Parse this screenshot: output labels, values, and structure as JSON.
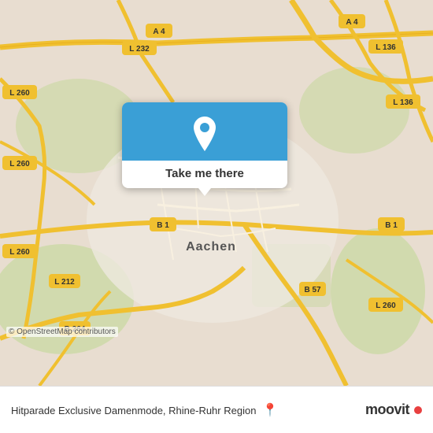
{
  "map": {
    "background_color": "#e8e0d8",
    "road_color": "#f5f0e0",
    "highway_color": "#f5d76e",
    "green_color": "#c8d8a0",
    "center": {
      "lat": 50.776,
      "lng": 6.084
    }
  },
  "popup": {
    "button_label": "Take me there",
    "bg_color": "#3a9fd6"
  },
  "bottom_bar": {
    "location_text": "Hitparade Exclusive Damenmode, Rhine-Ruhr Region",
    "copyright": "© OpenStreetMap contributors",
    "logo_text": "moovit"
  },
  "road_labels": [
    {
      "id": "a4-top",
      "text": "A 4"
    },
    {
      "id": "a4-topright",
      "text": "A 4"
    },
    {
      "id": "l232",
      "text": "L 232"
    },
    {
      "id": "l260-left1",
      "text": "L 260"
    },
    {
      "id": "l260-left2",
      "text": "L 260"
    },
    {
      "id": "l260-left3",
      "text": "L 260"
    },
    {
      "id": "l136-right1",
      "text": "L 136"
    },
    {
      "id": "l136-right2",
      "text": "L 136"
    },
    {
      "id": "b1-right",
      "text": "B 1"
    },
    {
      "id": "b1-bottom",
      "text": "B 1"
    },
    {
      "id": "b57",
      "text": "B 57"
    },
    {
      "id": "b264",
      "text": "B 264"
    },
    {
      "id": "l212",
      "text": "L 212"
    },
    {
      "id": "l260-right",
      "text": "L 260"
    },
    {
      "id": "aachen-label",
      "text": "Aachen"
    }
  ]
}
